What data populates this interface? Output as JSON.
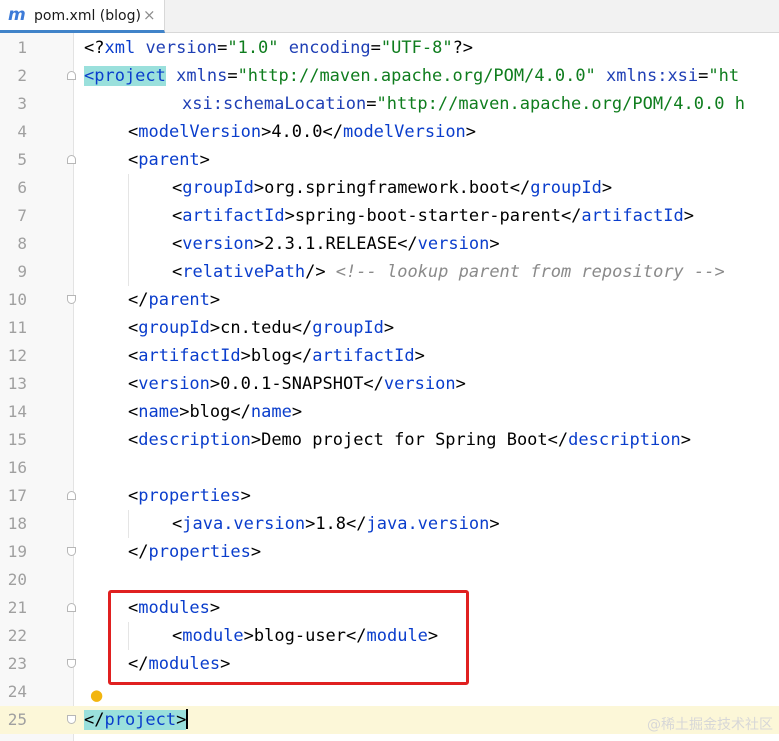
{
  "tab": {
    "icon_letter": "m",
    "title": "pom.xml (blog)",
    "close_glyph": "×"
  },
  "editor": {
    "lines": [
      {
        "n": "1"
      },
      {
        "n": "2"
      },
      {
        "n": "3"
      },
      {
        "n": "4"
      },
      {
        "n": "5"
      },
      {
        "n": "6"
      },
      {
        "n": "7"
      },
      {
        "n": "8"
      },
      {
        "n": "9"
      },
      {
        "n": "10"
      },
      {
        "n": "11"
      },
      {
        "n": "12"
      },
      {
        "n": "13"
      },
      {
        "n": "14"
      },
      {
        "n": "15"
      },
      {
        "n": "16"
      },
      {
        "n": "17"
      },
      {
        "n": "18"
      },
      {
        "n": "19"
      },
      {
        "n": "20"
      },
      {
        "n": "21"
      },
      {
        "n": "22"
      },
      {
        "n": "23"
      },
      {
        "n": "24"
      },
      {
        "n": "25"
      }
    ],
    "t": {
      "l1a": "<?",
      "l1b": "xml",
      "l1c": " version",
      "l1d": "=",
      "l1e": "\"1.0\"",
      "l1f": " encoding",
      "l1g": "=",
      "l1h": "\"UTF-8\"",
      "l1i": "?>",
      "l2a": "<project",
      "l2b": " xmlns",
      "l2c": "=",
      "l2d": "\"http://maven.apache.org/POM/4.0.0\"",
      "l2e": " xmlns:xsi",
      "l2f": "=",
      "l2g": "\"ht",
      "l3a": "xsi:schemaLocation",
      "l3b": "=",
      "l3c": "\"http://maven.apache.org/POM/4.0.0 h",
      "l4a": "<",
      "l4b": "modelVersion",
      "l4c": ">4.0.0</",
      "l4d": "modelVersion",
      "l4e": ">",
      "l5a": "<",
      "l5b": "parent",
      "l5c": ">",
      "l6a": "<",
      "l6b": "groupId",
      "l6c": ">org.springframework.boot</",
      "l6d": "groupId",
      "l6e": ">",
      "l7a": "<",
      "l7b": "artifactId",
      "l7c": ">spring-boot-starter-parent</",
      "l7d": "artifactId",
      "l7e": ">",
      "l8a": "<",
      "l8b": "version",
      "l8c": ">2.3.1.RELEASE</",
      "l8d": "version",
      "l8e": ">",
      "l9a": "<",
      "l9b": "relativePath",
      "l9c": "/> ",
      "l9d": "<!-- lookup parent from repository -->",
      "l10a": "</",
      "l10b": "parent",
      "l10c": ">",
      "l11a": "<",
      "l11b": "groupId",
      "l11c": ">cn.tedu</",
      "l11d": "groupId",
      "l11e": ">",
      "l12a": "<",
      "l12b": "artifactId",
      "l12c": ">blog</",
      "l12d": "artifactId",
      "l12e": ">",
      "l13a": "<",
      "l13b": "version",
      "l13c": ">0.0.1-SNAPSHOT</",
      "l13d": "version",
      "l13e": ">",
      "l14a": "<",
      "l14b": "name",
      "l14c": ">blog</",
      "l14d": "name",
      "l14e": ">",
      "l15a": "<",
      "l15b": "description",
      "l15c": ">Demo project for Spring Boot</",
      "l15d": "description",
      "l15e": ">",
      "l17a": "<",
      "l17b": "properties",
      "l17c": ">",
      "l18a": "<",
      "l18b": "java.version",
      "l18c": ">1.8</",
      "l18d": "java.version",
      "l18e": ">",
      "l19a": "</",
      "l19b": "properties",
      "l19c": ">",
      "l21a": "<",
      "l21b": "modules",
      "l21c": ">",
      "l22a": "<",
      "l22b": "module",
      "l22c": ">blog-user</",
      "l22d": "module",
      "l22e": ">",
      "l23a": "</",
      "l23b": "modules",
      "l23c": ">",
      "l25a": "</",
      "l25b": "project",
      "l25c": ">"
    }
  },
  "watermark": "@稀土掘金技术社区",
  "colors": {
    "tag": "#0a3dcc",
    "attr_value": "#0f7d1e",
    "comment": "#8a8a8a",
    "highlight_box": "#e02020",
    "current_line": "#fcf7d8",
    "tab_accent": "#4083c9"
  }
}
